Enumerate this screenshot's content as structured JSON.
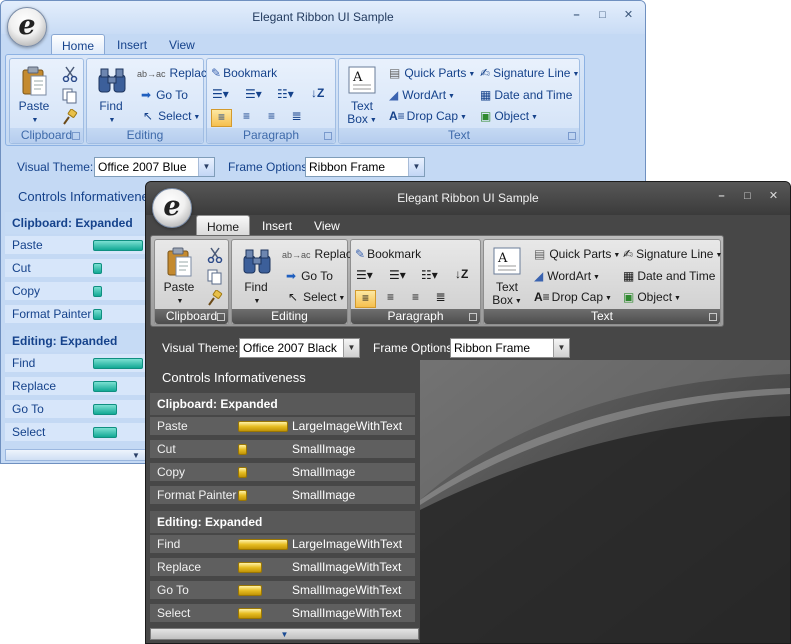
{
  "app": {
    "title": "Elegant Ribbon UI Sample",
    "logo_letter": "e",
    "window_buttons": [
      "–",
      "□",
      "✕"
    ]
  },
  "tabs": [
    "Home",
    "Insert",
    "View"
  ],
  "ribbon": {
    "clipboard": {
      "label": "Clipboard",
      "paste": "Paste"
    },
    "editing": {
      "label": "Editing",
      "find": "Find",
      "replace": "Replace",
      "goto": "Go To",
      "select": "Select"
    },
    "paragraph": {
      "label": "Paragraph",
      "bookmark": "Bookmark"
    },
    "text": {
      "label": "Text",
      "textbox_line1": "Text",
      "textbox_line2": "Box",
      "quick_parts": "Quick Parts",
      "wordart": "WordArt",
      "drop_cap": "Drop Cap",
      "signature_line": "Signature Line",
      "date_time": "Date and Time",
      "object": "Object"
    }
  },
  "options": {
    "visual_theme_label": "Visual Theme:",
    "frame_options_label": "Frame Options:",
    "blue_theme_value": "Office 2007 Blue",
    "black_theme_value": "Office 2007 Black",
    "frame_value": "Ribbon Frame"
  },
  "informativeness": {
    "heading": "Controls Informativeness",
    "blue_heading": "Controls Informativene",
    "clipboard_section": "Clipboard: Expanded",
    "editing_section": "Editing: Expanded",
    "clipboard_rows": [
      {
        "name": "Paste",
        "kind": "LargeImageWithText"
      },
      {
        "name": "Cut",
        "kind": "SmallImage"
      },
      {
        "name": "Copy",
        "kind": "SmallImage"
      },
      {
        "name": "Format Painter",
        "kind": "SmallImage"
      }
    ],
    "editing_rows": [
      {
        "name": "Find",
        "kind": "LargeImageWithText"
      },
      {
        "name": "Replace",
        "kind": "SmallImageWithText"
      },
      {
        "name": "Go To",
        "kind": "SmallImageWithText"
      },
      {
        "name": "Select",
        "kind": "SmallImageWithText"
      }
    ]
  },
  "colors": {
    "blue_bar": "#12a995",
    "black_bar": "#e7bd22"
  }
}
